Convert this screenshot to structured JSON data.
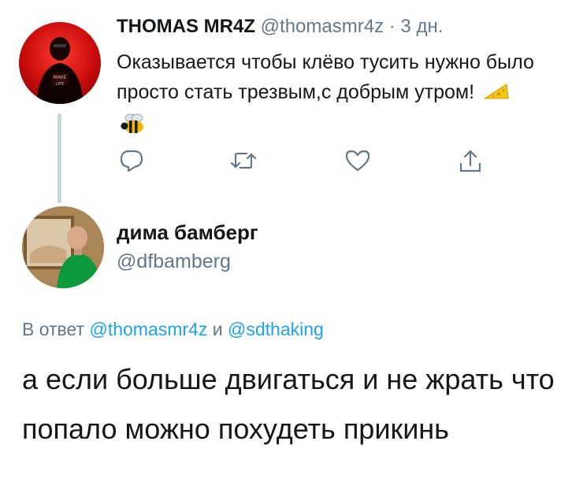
{
  "tweet1": {
    "name": "THOMAS MR4Z",
    "handle": "@thomasmr4z",
    "separator": "·",
    "time": "3 дн.",
    "text": "Оказывается чтобы клёво тусить нужно было просто стать трезвым,с добрым утром!",
    "emojis": [
      "cheese-icon",
      "bee-icon"
    ]
  },
  "actions": {
    "icons": [
      "reply-icon",
      "retweet-icon",
      "like-icon",
      "share-icon"
    ]
  },
  "tweet2": {
    "name": "дима бамберг",
    "handle": "@dfbamberg",
    "reply_prefix": "В ответ",
    "mention1": "@thomasmr4z",
    "conjunction": "и",
    "mention2": "@sdthaking",
    "text": "а если больше двигаться и не жрать что попало можно похудеть прикинь"
  },
  "colors": {
    "accent": "#1da1f2",
    "secondary_text": "#657786",
    "primary_text": "#14171a",
    "thread_line": "#ccd6dd"
  }
}
